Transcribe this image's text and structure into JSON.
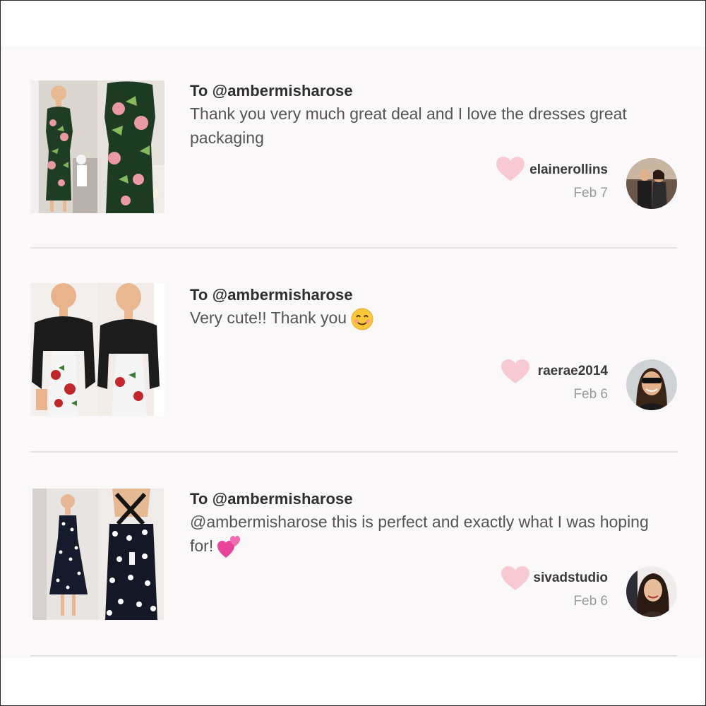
{
  "reviews": [
    {
      "to_label": "To @ambermisharose",
      "message": "Thank you very much great deal and I love the dresses great packaging",
      "emoji": "",
      "username": "elainerollins",
      "date": "Feb 7"
    },
    {
      "to_label": "To @ambermisharose",
      "message": "Very cute!! Thank you",
      "emoji": "smiling-face-emoji",
      "username": "raerae2014",
      "date": "Feb 6"
    },
    {
      "to_label": "To @ambermisharose",
      "message": "@ambermisharose this is perfect and exactly what I was hoping for!",
      "emoji": "two-hearts-emoji",
      "username": "sivadstudio",
      "date": "Feb 6"
    }
  ],
  "colors": {
    "panel_bg": "#faf8f9",
    "heart": "#f7c9d2",
    "divider": "#e4e1e3"
  }
}
